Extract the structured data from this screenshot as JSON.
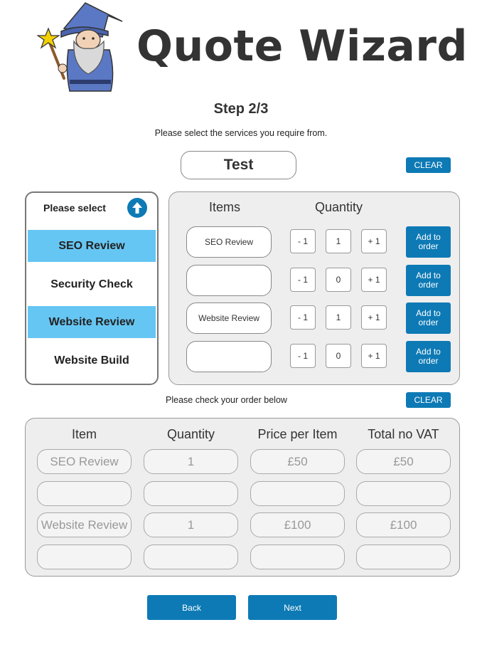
{
  "header": {
    "title": "Quote Wizard",
    "step": "Step 2/3",
    "instruction": "Please select the services you require from."
  },
  "quote": {
    "name": "Test",
    "clear_label": "CLEAR"
  },
  "services": {
    "heading": "Please select",
    "items": [
      {
        "label": "SEO Review",
        "selected": true
      },
      {
        "label": "Security Check",
        "selected": false
      },
      {
        "label": "Website Review",
        "selected": true
      },
      {
        "label": "Website Build",
        "selected": false
      }
    ]
  },
  "items_panel": {
    "items_header": "Items",
    "quantity_header": "Quantity",
    "minus_label": "- 1",
    "plus_label": "+ 1",
    "add_label": "Add to order",
    "rows": [
      {
        "name": "SEO Review",
        "qty": "1"
      },
      {
        "name": "",
        "qty": "0"
      },
      {
        "name": "Website Review",
        "qty": "1"
      },
      {
        "name": "",
        "qty": "0"
      }
    ]
  },
  "order": {
    "check_text": "Please check your order below",
    "clear_label": "CLEAR",
    "headers": [
      "Item",
      "Quantity",
      "Price per Item",
      "Total no VAT"
    ],
    "rows": [
      [
        "SEO Review",
        "1",
        "£50",
        "£50"
      ],
      [
        "",
        "",
        "",
        ""
      ],
      [
        "Website Review",
        "1",
        "£100",
        "£100"
      ],
      [
        "",
        "",
        "",
        ""
      ]
    ]
  },
  "nav": {
    "back_label": "Back",
    "next_label": "Next"
  },
  "colors": {
    "accent": "#0d7ab5",
    "selected": "#66c6f3",
    "panel": "#eeeeee"
  },
  "icons": {
    "logo": "wizard-logo",
    "scroll": "arrow-up-circle-icon"
  }
}
